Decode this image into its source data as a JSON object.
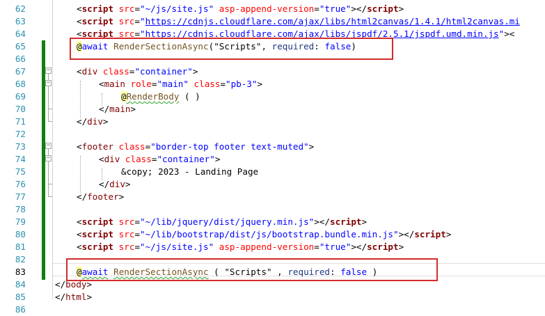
{
  "editor": {
    "lines": [
      {
        "num": "62",
        "tokens": [
          {
            "t": "<",
            "c": "t-punct"
          },
          {
            "t": "script",
            "c": "t-tagb"
          },
          {
            "t": " src",
            "c": "t-attr"
          },
          {
            "t": "=",
            "c": "t-punct"
          },
          {
            "t": "\"~/js/site.js\"",
            "c": "t-str"
          },
          {
            "t": " asp-append-version",
            "c": "t-attr"
          },
          {
            "t": "=",
            "c": "t-punct"
          },
          {
            "t": "\"true\"",
            "c": "t-str"
          },
          {
            "t": "></",
            "c": "t-punct"
          },
          {
            "t": "script",
            "c": "t-tagb"
          },
          {
            "t": ">",
            "c": "t-punct"
          }
        ]
      },
      {
        "num": "63",
        "tokens": [
          {
            "t": "<",
            "c": "t-punct"
          },
          {
            "t": "script",
            "c": "t-tagb"
          },
          {
            "t": " src",
            "c": "t-attr"
          },
          {
            "t": "=",
            "c": "t-punct"
          },
          {
            "t": "\"",
            "c": "t-str"
          },
          {
            "t": "https://cdnjs.cloudflare.com/ajax/libs/html2canvas/1.4.1/html2canvas.mi",
            "c": "t-link"
          }
        ]
      },
      {
        "num": "64",
        "tokens": [
          {
            "t": "<",
            "c": "t-punct"
          },
          {
            "t": "script",
            "c": "t-tagb"
          },
          {
            "t": " src",
            "c": "t-attr"
          },
          {
            "t": "=",
            "c": "t-punct"
          },
          {
            "t": "\"",
            "c": "t-str"
          },
          {
            "t": "https://cdnjs.cloudflare.com/ajax/libs/jspdf/2.5.1/jspdf.umd.min.js",
            "c": "t-link"
          },
          {
            "t": "\"",
            "c": "t-str"
          },
          {
            "t": "><",
            "c": "t-punct"
          }
        ]
      },
      {
        "num": "65",
        "tokens": [
          {
            "t": "@",
            "c": "t-razor"
          },
          {
            "t": "await",
            "c": "t-kw"
          },
          {
            "t": " ",
            "c": "t-plain"
          },
          {
            "t": "RenderSectionAsync",
            "c": "t-method"
          },
          {
            "t": "(",
            "c": "t-plain"
          },
          {
            "t": "\"Scripts\"",
            "c": "t-strq"
          },
          {
            "t": ", ",
            "c": "t-plain"
          },
          {
            "t": "required",
            "c": "t-param"
          },
          {
            "t": ": ",
            "c": "t-plain"
          },
          {
            "t": "false",
            "c": "t-kw"
          },
          {
            "t": ")",
            "c": "t-plain"
          }
        ]
      },
      {
        "num": "66",
        "tokens": []
      },
      {
        "num": "67",
        "tokens": [
          {
            "t": "<",
            "c": "t-punct"
          },
          {
            "t": "div",
            "c": "t-tag"
          },
          {
            "t": " class",
            "c": "t-attr"
          },
          {
            "t": "=",
            "c": "t-punct"
          },
          {
            "t": "\"container\"",
            "c": "t-str"
          },
          {
            "t": ">",
            "c": "t-punct"
          }
        ]
      },
      {
        "num": "68",
        "tokens": [
          {
            "t": "<",
            "c": "t-punct"
          },
          {
            "t": "main",
            "c": "t-tag"
          },
          {
            "t": " role",
            "c": "t-attr"
          },
          {
            "t": "=",
            "c": "t-punct"
          },
          {
            "t": "\"main\"",
            "c": "t-str"
          },
          {
            "t": " class",
            "c": "t-attr"
          },
          {
            "t": "=",
            "c": "t-punct"
          },
          {
            "t": "\"pb-3\"",
            "c": "t-str"
          },
          {
            "t": ">",
            "c": "t-punct"
          }
        ]
      },
      {
        "num": "69",
        "tokens": [
          {
            "t": "@",
            "c": "t-razor"
          },
          {
            "t": "RenderBody",
            "c": "t-method squig"
          },
          {
            "t": " ( )",
            "c": "t-plain"
          }
        ]
      },
      {
        "num": "70",
        "tokens": [
          {
            "t": "</",
            "c": "t-punct"
          },
          {
            "t": "main",
            "c": "t-tag"
          },
          {
            "t": ">",
            "c": "t-punct"
          }
        ]
      },
      {
        "num": "71",
        "tokens": [
          {
            "t": "</",
            "c": "t-punct"
          },
          {
            "t": "div",
            "c": "t-tag"
          },
          {
            "t": ">",
            "c": "t-punct"
          }
        ]
      },
      {
        "num": "72",
        "tokens": []
      },
      {
        "num": "73",
        "tokens": [
          {
            "t": "<",
            "c": "t-punct"
          },
          {
            "t": "footer",
            "c": "t-tag"
          },
          {
            "t": " class",
            "c": "t-attr"
          },
          {
            "t": "=",
            "c": "t-punct"
          },
          {
            "t": "\"border-top footer text-muted\"",
            "c": "t-str"
          },
          {
            "t": ">",
            "c": "t-punct"
          }
        ]
      },
      {
        "num": "74",
        "tokens": [
          {
            "t": "<",
            "c": "t-punct"
          },
          {
            "t": "div",
            "c": "t-tag"
          },
          {
            "t": " class",
            "c": "t-attr"
          },
          {
            "t": "=",
            "c": "t-punct"
          },
          {
            "t": "\"container\"",
            "c": "t-str"
          },
          {
            "t": ">",
            "c": "t-punct"
          }
        ]
      },
      {
        "num": "75",
        "tokens": [
          {
            "t": "&copy; 2023 - Landing Page",
            "c": "t-plain"
          }
        ]
      },
      {
        "num": "76",
        "tokens": [
          {
            "t": "</",
            "c": "t-punct"
          },
          {
            "t": "div",
            "c": "t-tag"
          },
          {
            "t": ">",
            "c": "t-punct"
          }
        ]
      },
      {
        "num": "77",
        "tokens": [
          {
            "t": "</",
            "c": "t-punct"
          },
          {
            "t": "footer",
            "c": "t-tag"
          },
          {
            "t": ">",
            "c": "t-punct"
          }
        ]
      },
      {
        "num": "78",
        "tokens": []
      },
      {
        "num": "79",
        "tokens": [
          {
            "t": "<",
            "c": "t-punct"
          },
          {
            "t": "script",
            "c": "t-tagb"
          },
          {
            "t": " src",
            "c": "t-attr"
          },
          {
            "t": "=",
            "c": "t-punct"
          },
          {
            "t": "\"~/lib/jquery/dist/jquery.min.js\"",
            "c": "t-str"
          },
          {
            "t": "></",
            "c": "t-punct"
          },
          {
            "t": "script",
            "c": "t-tagb"
          },
          {
            "t": ">",
            "c": "t-punct"
          }
        ]
      },
      {
        "num": "80",
        "tokens": [
          {
            "t": "<",
            "c": "t-punct"
          },
          {
            "t": "script",
            "c": "t-tagb"
          },
          {
            "t": " src",
            "c": "t-attr"
          },
          {
            "t": "=",
            "c": "t-punct"
          },
          {
            "t": "\"~/lib/bootstrap/dist/js/bootstrap.bundle.min.js\"",
            "c": "t-str"
          },
          {
            "t": "></",
            "c": "t-punct"
          },
          {
            "t": "script",
            "c": "t-tagb"
          },
          {
            "t": ">",
            "c": "t-punct"
          }
        ]
      },
      {
        "num": "81",
        "tokens": [
          {
            "t": "<",
            "c": "t-punct"
          },
          {
            "t": "script",
            "c": "t-tagb"
          },
          {
            "t": " src",
            "c": "t-attr"
          },
          {
            "t": "=",
            "c": "t-punct"
          },
          {
            "t": "\"~/js/site.js\"",
            "c": "t-str"
          },
          {
            "t": " asp-append-version",
            "c": "t-attr"
          },
          {
            "t": "=",
            "c": "t-punct"
          },
          {
            "t": "\"true\"",
            "c": "t-str"
          },
          {
            "t": "></",
            "c": "t-punct"
          },
          {
            "t": "script",
            "c": "t-tagb"
          },
          {
            "t": ">",
            "c": "t-punct"
          }
        ]
      },
      {
        "num": "82",
        "tokens": []
      },
      {
        "num": "83",
        "tokens": [
          {
            "t": "@",
            "c": "t-razor"
          },
          {
            "t": "await",
            "c": "t-kw squig"
          },
          {
            "t": " ",
            "c": "t-plain"
          },
          {
            "t": "RenderSectionAsync",
            "c": "t-method squig"
          },
          {
            "t": " ( ",
            "c": "t-plain"
          },
          {
            "t": "\"Scripts\"",
            "c": "t-strq"
          },
          {
            "t": " , ",
            "c": "t-plain"
          },
          {
            "t": "required",
            "c": "t-param"
          },
          {
            "t": ": ",
            "c": "t-plain"
          },
          {
            "t": "false",
            "c": "t-kw"
          },
          {
            "t": " )",
            "c": "t-plain"
          }
        ]
      },
      {
        "num": "84",
        "tokens": [
          {
            "t": "</",
            "c": "t-punct"
          },
          {
            "t": "body",
            "c": "t-tag"
          },
          {
            "t": ">",
            "c": "t-punct"
          }
        ]
      },
      {
        "num": "85",
        "tokens": [
          {
            "t": "</",
            "c": "t-punct"
          },
          {
            "t": "html",
            "c": "t-tag"
          },
          {
            "t": ">",
            "c": "t-punct"
          }
        ]
      },
      {
        "num": "86",
        "tokens": []
      }
    ],
    "current_line": "83",
    "fold_icon": "minus-icon"
  }
}
